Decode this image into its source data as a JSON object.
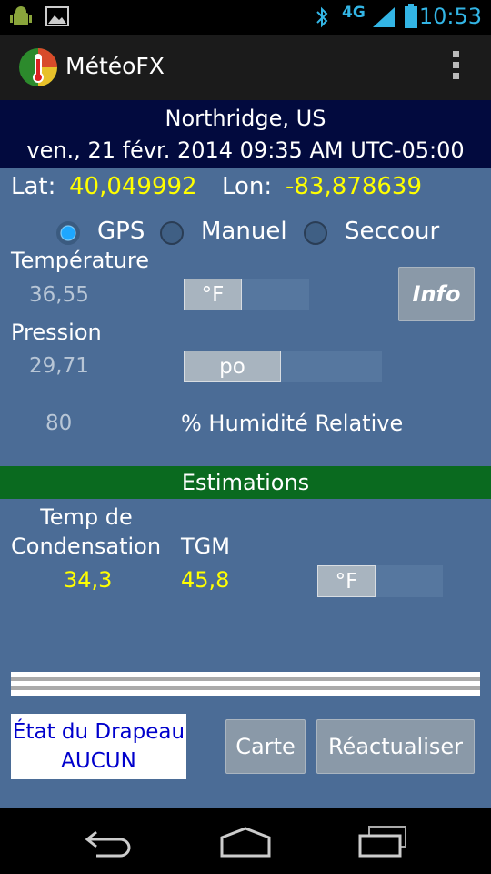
{
  "status_bar": {
    "time": "10:53",
    "network": "4G"
  },
  "app": {
    "title": "MétéoFX"
  },
  "location": {
    "place": "Northridge, US",
    "datetime": "ven., 21 févr. 2014 09:35 AM UTC-05:00"
  },
  "coords": {
    "lat_label": "Lat:",
    "lat_value": "40,049992",
    "lon_label": "Lon:",
    "lon_value": "-83,878639"
  },
  "source": {
    "options": [
      "GPS",
      "Manuel",
      "Seccour"
    ],
    "selected": "GPS"
  },
  "inputs": {
    "temperature_label": "Température",
    "temperature_value": "36,55",
    "temperature_unit": "°F",
    "info_label": "Info",
    "pressure_label": "Pression",
    "pressure_value": "29,71",
    "pressure_unit": "po",
    "humidity_value": "80",
    "humidity_label": "% Humidité Relative"
  },
  "estimations": {
    "header": "Estimations",
    "dew_label_1": "Temp de",
    "dew_label_2": "Condensation",
    "dew_value": "34,3",
    "tgm_label": "TGM",
    "tgm_value": "45,8",
    "unit": "°F"
  },
  "flag": {
    "line1": "État du Drapeau",
    "line2": "AUCUN"
  },
  "buttons": {
    "map": "Carte",
    "refresh": "Réactualiser"
  },
  "colors": {
    "accent": "#33b5e5",
    "value": "#ffff00",
    "panel": "#4b6c96",
    "header": "#020a3e",
    "estimations": "#0a6a1f"
  }
}
